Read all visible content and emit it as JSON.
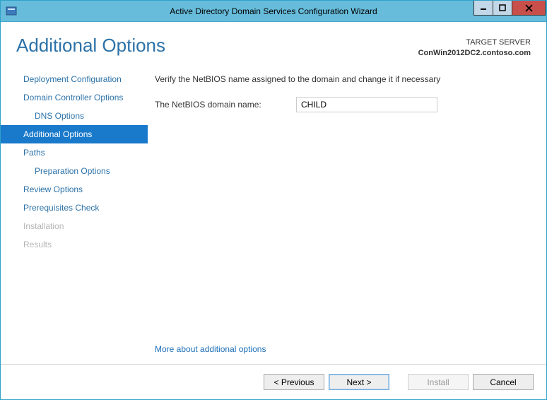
{
  "window": {
    "title": "Active Directory Domain Services Configuration Wizard"
  },
  "header": {
    "heading": "Additional Options",
    "target_label": "TARGET SERVER",
    "target_host": "ConWin2012DC2.contoso.com"
  },
  "sidebar": {
    "items": [
      {
        "label": "Deployment Configuration",
        "indent": false,
        "selected": false,
        "disabled": false
      },
      {
        "label": "Domain Controller Options",
        "indent": false,
        "selected": false,
        "disabled": false
      },
      {
        "label": "DNS Options",
        "indent": true,
        "selected": false,
        "disabled": false
      },
      {
        "label": "Additional Options",
        "indent": false,
        "selected": true,
        "disabled": false
      },
      {
        "label": "Paths",
        "indent": false,
        "selected": false,
        "disabled": false
      },
      {
        "label": "Preparation Options",
        "indent": true,
        "selected": false,
        "disabled": false
      },
      {
        "label": "Review Options",
        "indent": false,
        "selected": false,
        "disabled": false
      },
      {
        "label": "Prerequisites Check",
        "indent": false,
        "selected": false,
        "disabled": false
      },
      {
        "label": "Installation",
        "indent": false,
        "selected": false,
        "disabled": true
      },
      {
        "label": "Results",
        "indent": false,
        "selected": false,
        "disabled": true
      }
    ]
  },
  "content": {
    "instruction": "Verify the NetBIOS name assigned to the domain and change it if necessary",
    "netbios_label": "The NetBIOS domain name:",
    "netbios_value": "CHILD",
    "more_link": "More about additional options"
  },
  "footer": {
    "previous": "< Previous",
    "next": "Next >",
    "install": "Install",
    "cancel": "Cancel"
  }
}
